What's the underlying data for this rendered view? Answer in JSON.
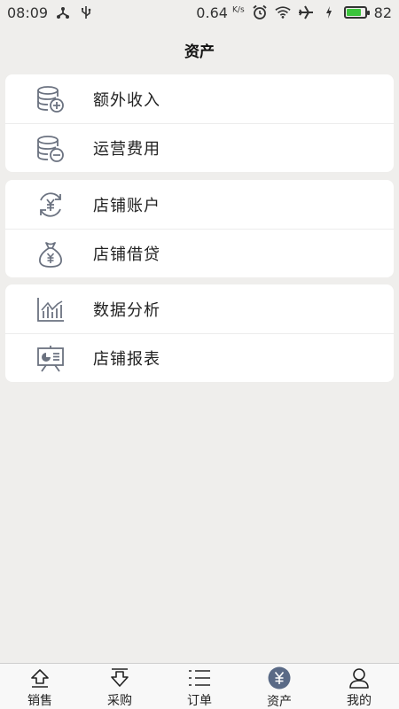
{
  "status_bar": {
    "time": "08:09",
    "speed_value": "0.64",
    "speed_unit": "K/s",
    "battery_level": "82",
    "battery_fill_percent": 82,
    "battery_color": "#3cc43c"
  },
  "header": {
    "title": "资产"
  },
  "groups": [
    {
      "items": [
        {
          "label": "额外收入",
          "icon": "database-add-icon"
        },
        {
          "label": "运营费用",
          "icon": "database-minus-icon"
        }
      ]
    },
    {
      "items": [
        {
          "label": "店铺账户",
          "icon": "yuan-exchange-icon"
        },
        {
          "label": "店铺借贷",
          "icon": "money-bag-icon"
        }
      ]
    },
    {
      "items": [
        {
          "label": "数据分析",
          "icon": "bar-chart-icon"
        },
        {
          "label": "店铺报表",
          "icon": "presentation-board-icon"
        }
      ]
    }
  ],
  "tab_bar": {
    "tabs": [
      {
        "label": "销售",
        "icon": "upload-arrow-icon",
        "active": false
      },
      {
        "label": "采购",
        "icon": "download-arrow-icon",
        "active": false
      },
      {
        "label": "订单",
        "icon": "list-icon",
        "active": false
      },
      {
        "label": "资产",
        "icon": "yuan-circle-icon",
        "active": true
      },
      {
        "label": "我的",
        "icon": "user-icon",
        "active": false
      }
    ],
    "active_color": "#5a6a86"
  },
  "colors": {
    "background": "#efeeec",
    "card": "#ffffff",
    "icon_gray": "#6b7280"
  }
}
